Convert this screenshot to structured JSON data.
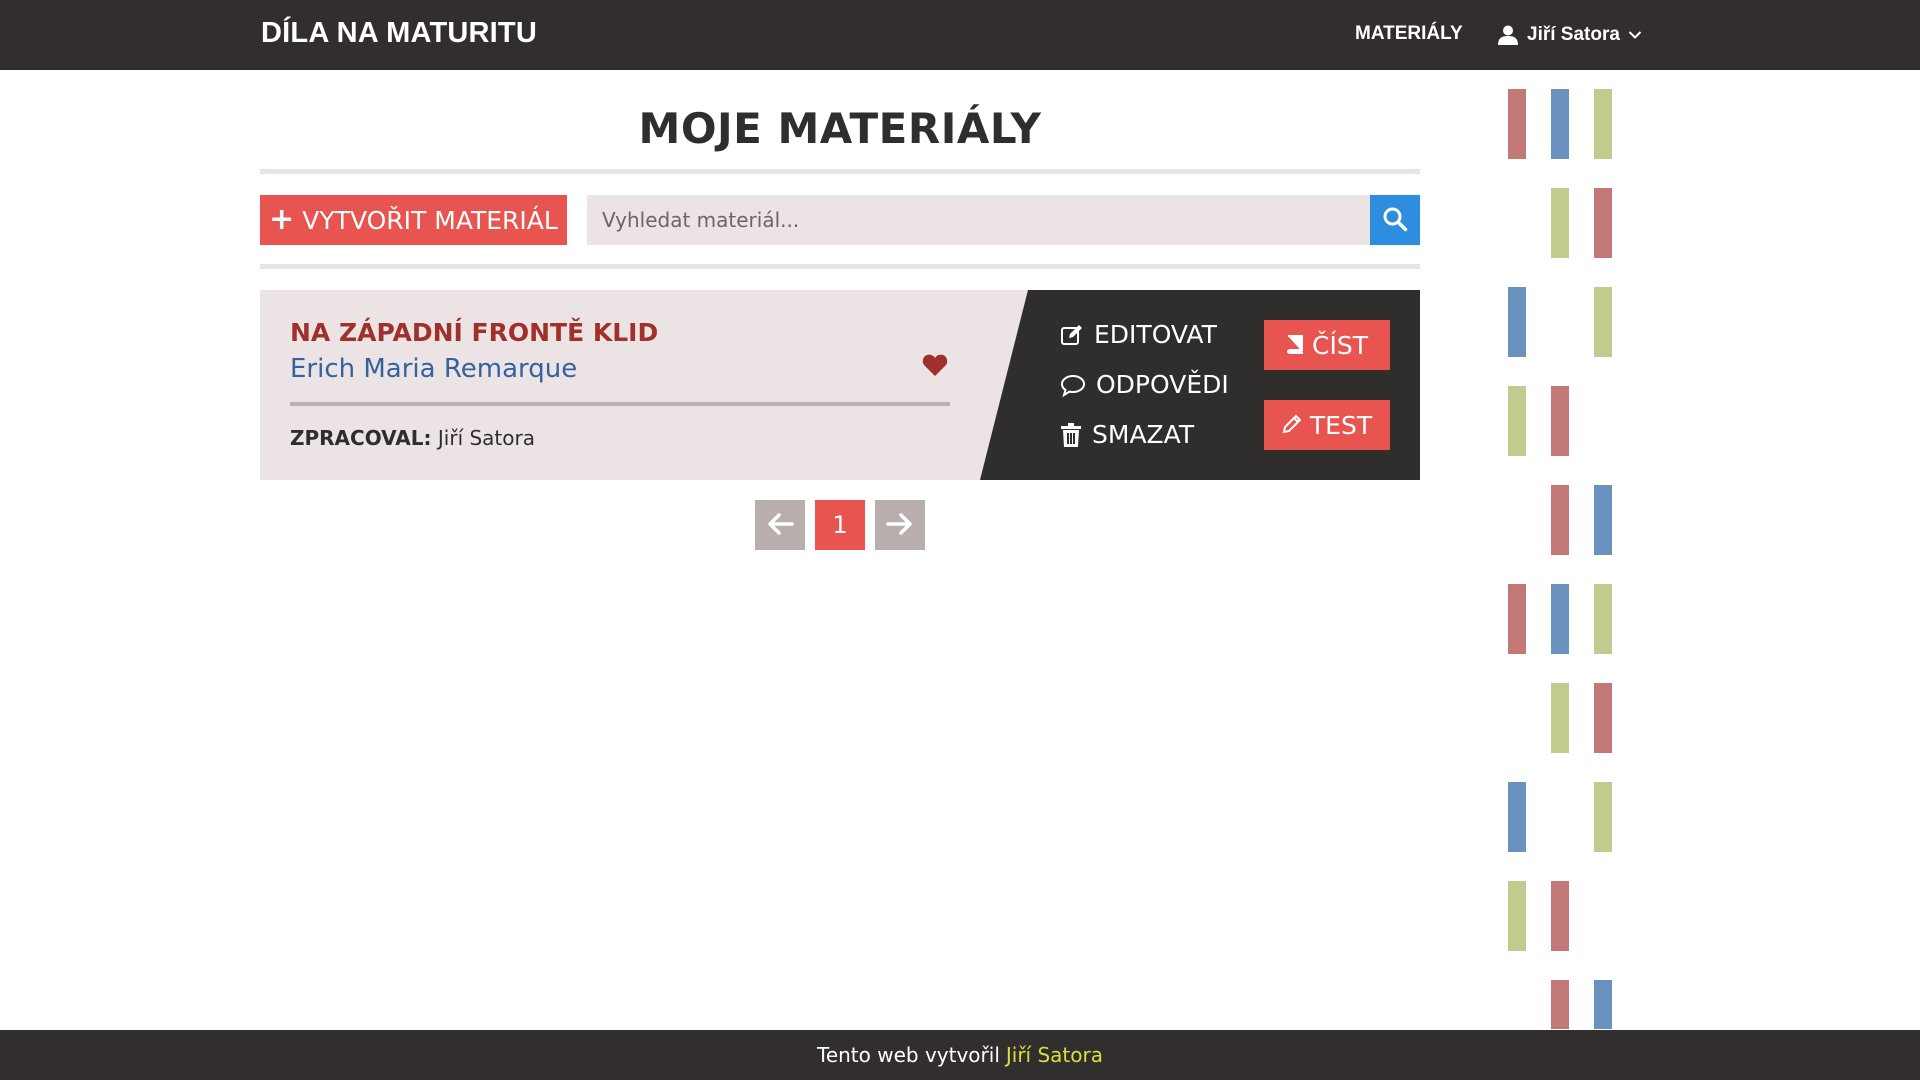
{
  "header": {
    "brand": "DÍLA NA MATURITU",
    "nav_materials": "MATERIÁLY",
    "user_name": "Jiří Satora"
  },
  "main": {
    "title": "MOJE MATERIÁLY",
    "create_label": "VYTVOŘIT MATERIÁL",
    "search_placeholder": "Vyhledat materiál..."
  },
  "card": {
    "title": "NA ZÁPADNÍ FRONTĚ KLID",
    "author": "Erich Maria Remarque",
    "meta_label": "ZPRACOVAL:",
    "meta_value": "Jiří Satora",
    "favorite": true,
    "actions": {
      "edit": "EDITOVAT",
      "answers": "ODPOVĚDI",
      "delete": "SMAZAT",
      "read": "ČÍST",
      "test": "TEST"
    }
  },
  "pagination": {
    "current_page": "1"
  },
  "footer": {
    "text": "Tento web vytvořil",
    "author": "Jiří Satora"
  },
  "colors": {
    "dark": "#322e2e",
    "accent_red": "#e8544f",
    "search_blue": "#2d8ee0",
    "title_red": "#a0302b",
    "author_blue": "#34629f",
    "footer_link": "#d8df40",
    "stripe_red": "#c27876",
    "stripe_blue": "#6b91bf",
    "stripe_green": "#c2cb8d"
  }
}
